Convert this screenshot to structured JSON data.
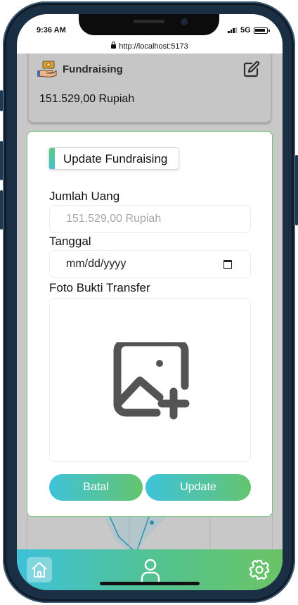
{
  "status_bar": {
    "time": "9:36 AM",
    "network": "5G"
  },
  "browser": {
    "url": "http://localhost:5173"
  },
  "summary_card": {
    "title": "Fundraising",
    "amount": "151.529,00 Rupiah",
    "icon": "money-hand-icon",
    "edit_icon": "edit-icon"
  },
  "modal": {
    "title": "Update Fundraising",
    "amount_label": "Jumlah Uang",
    "amount_placeholder": "151.529,00 Rupiah",
    "date_label": "Tanggal",
    "date_placeholder": "mm/dd/yyyy",
    "photo_label": "Foto Bukti Transfer",
    "photo_icon": "add-image-icon",
    "cancel_label": "Batal",
    "update_label": "Update"
  },
  "bottom_nav": {
    "items": [
      {
        "icon": "home-icon",
        "active": true
      },
      {
        "icon": "user-icon",
        "active": false
      },
      {
        "icon": "gear-icon",
        "active": false
      }
    ]
  },
  "colors": {
    "accent_start": "#3fc3dc",
    "accent_end": "#64c46e",
    "modal_border": "#6cc37c"
  }
}
